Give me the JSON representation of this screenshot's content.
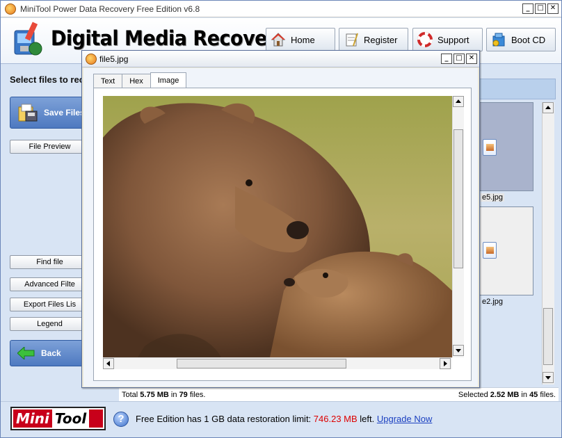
{
  "window": {
    "title": "MiniTool Power Data Recovery Free Edition v6.8"
  },
  "banner": {
    "title": "Digital Media Recovery"
  },
  "nav": [
    {
      "label": "Home",
      "icon": "home-icon"
    },
    {
      "label": "Register",
      "icon": "register-icon"
    },
    {
      "label": "Support",
      "icon": "support-icon"
    },
    {
      "label": "Boot CD",
      "icon": "boot-cd-icon"
    }
  ],
  "left": {
    "prompt": "Select files to rec",
    "save_label": "Save Files",
    "file_preview": "File Preview",
    "find_file": "Find file",
    "advanced_filter": "Advanced Filte",
    "export_list": "Export Files Lis",
    "legend": "Legend",
    "back_label": "Back"
  },
  "files": [
    {
      "name": "e5.jpg",
      "selected": true
    },
    {
      "name": "e2.jpg",
      "selected": false
    }
  ],
  "status": {
    "total_prefix": "Total ",
    "total_size": "5.75 MB",
    "total_mid": " in ",
    "total_count": "79",
    "total_suffix": " files.",
    "selected_prefix": "Selected ",
    "selected_size": "2.52 MB",
    "selected_mid": " in ",
    "selected_count": "45",
    "selected_suffix": " files."
  },
  "footer": {
    "logo_mini": "Mini",
    "logo_tool": "Tool",
    "text_prefix": "Free Edition has 1 GB data restoration limit: ",
    "remaining": "746.23 MB",
    "text_suffix": " left. ",
    "upgrade_link": "Upgrade Now"
  },
  "preview": {
    "title": "file5.jpg",
    "tabs": [
      "Text",
      "Hex",
      "Image"
    ],
    "active_tab": "Image"
  },
  "colors": {
    "accent_blue": "#4e79c0",
    "footer_red": "#dd0000",
    "link_blue": "#1a3fc0"
  }
}
